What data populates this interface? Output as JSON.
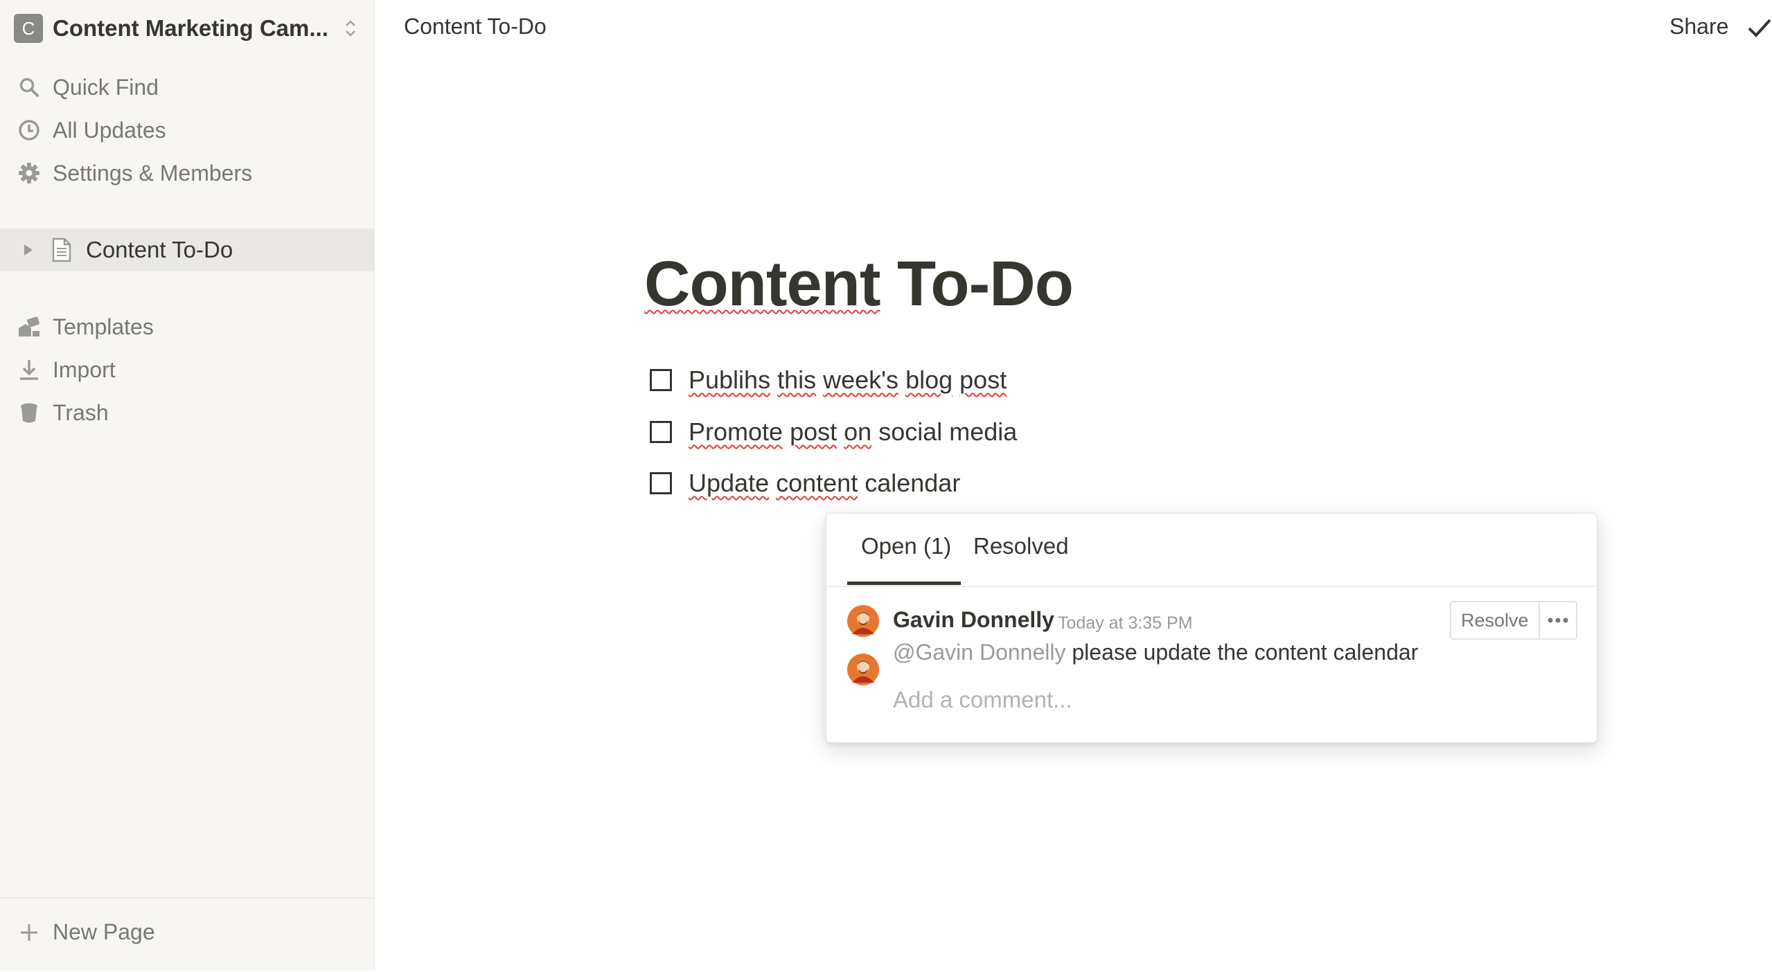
{
  "sidebar": {
    "workspace": {
      "initial": "C",
      "name": "Content Marketing Cam..."
    },
    "top_items": [
      {
        "label": "Quick Find",
        "icon": "search-icon"
      },
      {
        "label": "All Updates",
        "icon": "clock-icon"
      },
      {
        "label": "Settings & Members",
        "icon": "gear-icon"
      }
    ],
    "pages": [
      {
        "label": "Content To-Do",
        "icon": "document-icon"
      }
    ],
    "bottom_items": [
      {
        "label": "Templates",
        "icon": "templates-icon"
      },
      {
        "label": "Import",
        "icon": "import-icon"
      },
      {
        "label": "Trash",
        "icon": "trash-icon"
      }
    ],
    "new_page_label": "New Page"
  },
  "topbar": {
    "breadcrumb": "Content To-Do",
    "share_label": "Share"
  },
  "page": {
    "title": "Content To-Do",
    "todos": [
      {
        "text": "Publihs this week's blog post",
        "checked": false
      },
      {
        "text": "Promote post on social media",
        "checked": false
      },
      {
        "text": "Update content calendar",
        "checked": false
      }
    ]
  },
  "comments": {
    "tabs": [
      {
        "label": "Open (1)",
        "active": true
      },
      {
        "label": "Resolved",
        "active": false
      }
    ],
    "thread": {
      "author": "Gavin Donnelly",
      "timestamp": "Today at 3:35 PM",
      "mention": "@Gavin Donnelly",
      "body": "please update the content calendar",
      "resolve_label": "Resolve"
    },
    "add_placeholder": "Add a comment..."
  },
  "colors": {
    "sidebar_bg": "#f7f6f3",
    "text": "#37352f",
    "muted": "#787774",
    "spellcheck": "#e03e3e",
    "avatar_orange": "#e8772e"
  }
}
